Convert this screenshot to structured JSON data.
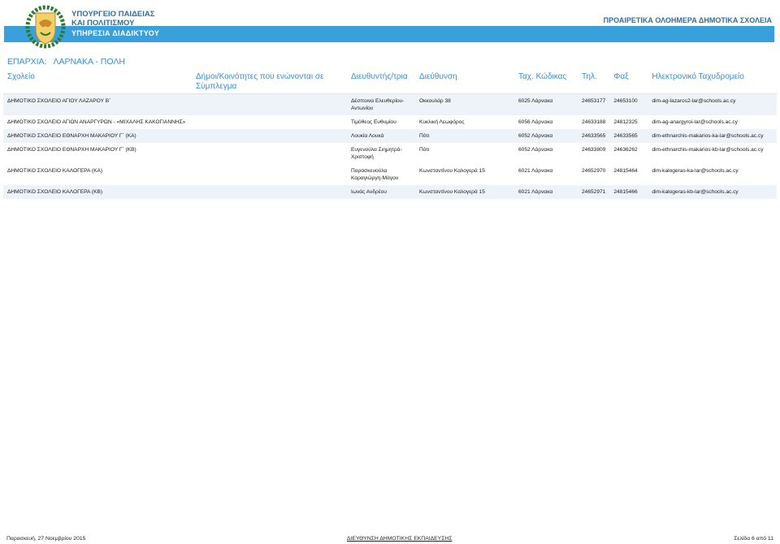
{
  "header": {
    "ministry_line1": "ΥΠΟΥΡΓΕΙΟ ΠΑΙΔΕΙΑΣ",
    "ministry_line2": "ΚΑΙ ΠΟΛΙΤΙΣΜΟΥ",
    "service": "ΥΠΗΡΕΣΙΑ ΔΙΑΔΙΚΤΥΟΥ",
    "doc_title": "ΠΡΟΑΙΡΕΤΙΚΑ ΟΛΟΗΜΕΡΑ ΔΗΜΟΤΙΚΑ ΣΧΟΛΕΙΑ"
  },
  "district": {
    "label": "ΕΠΑΡΧΙΑ:",
    "value": "ΛΑΡΝΑΚΑ - ΠΟΛΗ"
  },
  "table": {
    "columns": [
      "Σχολείο",
      "Δήμοι/Κοινότητες που ενώνονται σε Σύμπλεγμα",
      "Διευθυντής/τρια",
      "Διεύθυνση",
      "Ταχ. Κώδικας",
      "Τηλ.",
      "Φαξ",
      "Ηλεκτρονικό Ταχυδρομείο"
    ],
    "rows": [
      {
        "school": "ΔΗΜΟΤΙΚΟ ΣΧΟΛΕΙΟ ΑΓΙΟΥ ΛΑΖΑΡΟΥ Β΄",
        "municipalities": "",
        "principal": "Δέσποινα Ελευθερίου-Αντωνίου",
        "address": "Οκκουλάρ 38",
        "postal": "6025 Λάρνακα",
        "phone": "24653177",
        "fax": "24653100",
        "email": "dim-ag-lazaros2-lar@schools.ac.cy"
      },
      {
        "school": "ΔΗΜΟΤΙΚΟ ΣΧΟΛΕΙΟ ΑΓΙΩΝ ΑΝΑΡΓΥΡΩΝ - «ΜΙΧΑΛΗΣ ΚΑΚΟΓΙΑΝΝΗΣ»",
        "municipalities": "",
        "principal": "Τιμόθεος Ευθυμίου",
        "address": "Κυκλική Λεωφόρος",
        "postal": "6056 Λάρνακα",
        "phone": "24633188",
        "fax": "24812325",
        "email": "dim-ag-anargyroi-lar@schools.ac.cy"
      },
      {
        "school": "ΔΗΜΟΤΙΚΟ ΣΧΟΛΕΙΟ ΕΘΝΑΡΧΗ ΜΑΚΑΡΙΟΥ Γ΄ (ΚΑ)",
        "municipalities": "",
        "principal": "Λουκία Λουκά",
        "address": "Πότι",
        "postal": "6052 Λάρνακα",
        "phone": "24633565",
        "fax": "24633565",
        "email": "dim-ethnarchis-makarios-ka-lar@schools.ac.cy"
      },
      {
        "school": "ΔΗΜΟΤΙΚΟ ΣΧΟΛΕΙΟ ΕΘΝΑΡΧΗ ΜΑΚΑΡΙΟΥ Γ΄ (ΚΒ)",
        "municipalities": "",
        "principal": "Ευγενούλα Σιημητρά-Χριστοφή",
        "address": "Πότι",
        "postal": "6052 Λάρνακα",
        "phone": "24633809",
        "fax": "24636262",
        "email": "dim-ethnarchis-makarios-kb-lar@schools.ac.cy"
      },
      {
        "school": "ΔΗΜΟΤΙΚΟ ΣΧΟΛΕΙΟ ΚΑΛΟΓΕΡΑ (ΚΑ)",
        "municipalities": "",
        "principal": "Παρασκευούλα Καραγιώργη-Μάγου",
        "address": "Κωνσταντίνου Καλογερά 15",
        "postal": "6021 Λάρνακα",
        "phone": "24652970",
        "fax": "24815464",
        "email": "dim-kalogeras-ka-lar@schools.ac.cy"
      },
      {
        "school": "ΔΗΜΟΤΙΚΟ ΣΧΟΛΕΙΟ ΚΑΛΟΓΕΡΑ (ΚΒ)",
        "municipalities": "",
        "principal": "Ιωνάς Ανδρέου",
        "address": "Κωνσταντίνου Καλογερά 15",
        "postal": "6021 Λάρνακα",
        "phone": "24652971",
        "fax": "24815466",
        "email": "dim-kalogeras-kb-lar@schools.ac.cy"
      }
    ]
  },
  "footer": {
    "date": "Παρασκευή, 27 Νοεμβρίου 2015",
    "department": "ΔΙΕΥΘΥΝΣΗ ΔΗΜΟΤΙΚΗΣ ΕΚΠΑΙΔΕΥΣΗΣ",
    "page": "Σελίδα 6 από 11"
  },
  "colors": {
    "header_bar": "#3aa0dc",
    "heading_text": "#3a8fd0",
    "row_stripe": "#eef3f9",
    "ministry_text": "#2d6ea3"
  }
}
